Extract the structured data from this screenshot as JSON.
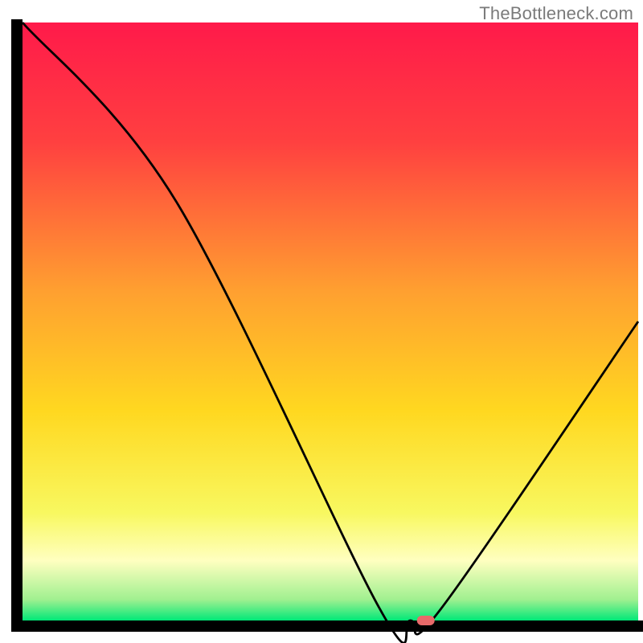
{
  "watermark": "TheBottleneck.com",
  "chart_data": {
    "type": "line",
    "title": "",
    "xlabel": "",
    "ylabel": "",
    "xlim": [
      0,
      100
    ],
    "ylim": [
      0,
      100
    ],
    "series": [
      {
        "name": "bottleneck-curve",
        "x": [
          0,
          25,
          58,
          63,
          68,
          100
        ],
        "y": [
          100,
          70,
          2,
          0,
          2,
          50
        ]
      }
    ],
    "marker": {
      "x": 65.5,
      "y": 0
    },
    "gradient_stops": [
      {
        "offset": 0.0,
        "color": "#ff1a4a"
      },
      {
        "offset": 0.2,
        "color": "#ff4040"
      },
      {
        "offset": 0.45,
        "color": "#ffa030"
      },
      {
        "offset": 0.65,
        "color": "#ffd820"
      },
      {
        "offset": 0.82,
        "color": "#f8f860"
      },
      {
        "offset": 0.9,
        "color": "#ffffc0"
      },
      {
        "offset": 0.965,
        "color": "#a0f090"
      },
      {
        "offset": 1.0,
        "color": "#00e878"
      }
    ]
  }
}
